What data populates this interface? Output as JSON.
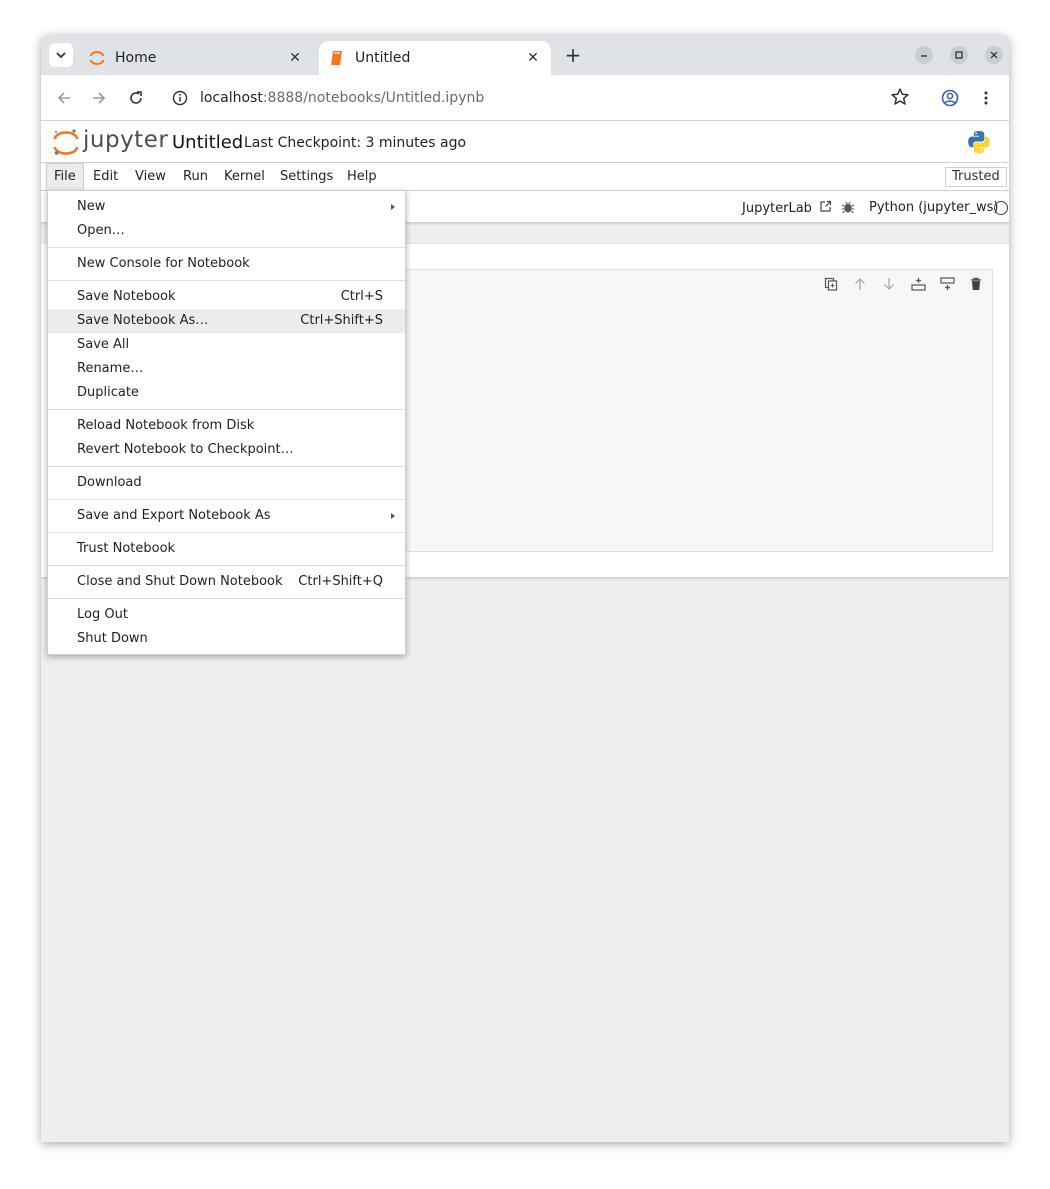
{
  "browser": {
    "tabs": [
      {
        "label": "Home",
        "active": false
      },
      {
        "label": "Untitled",
        "active": true
      }
    ],
    "url_host": "localhost",
    "url_rest": ":8888/notebooks/Untitled.ipynb"
  },
  "jupyter": {
    "wordmark": "jupyter",
    "notebook_title": "Untitled",
    "checkpoint": "Last Checkpoint: 3 minutes ago",
    "menu": [
      "File",
      "Edit",
      "View",
      "Run",
      "Kernel",
      "Settings",
      "Help"
    ],
    "trusted_label": "Trusted",
    "jupyterlab_link": "JupyterLab",
    "kernel_name": "Python (jupyter_ws)"
  },
  "file_menu": {
    "groups": [
      [
        {
          "label": "New",
          "submenu": true
        },
        {
          "label": "Open…"
        }
      ],
      [
        {
          "label": "New Console for Notebook"
        }
      ],
      [
        {
          "label": "Save Notebook",
          "shortcut": "Ctrl+S"
        },
        {
          "label": "Save Notebook As…",
          "shortcut": "Ctrl+Shift+S",
          "hover": true
        },
        {
          "label": "Save All"
        },
        {
          "label": "Rename…"
        },
        {
          "label": "Duplicate"
        }
      ],
      [
        {
          "label": "Reload Notebook from Disk"
        },
        {
          "label": "Revert Notebook to Checkpoint…"
        }
      ],
      [
        {
          "label": "Download"
        }
      ],
      [
        {
          "label": "Save and Export Notebook As",
          "submenu": true
        }
      ],
      [
        {
          "label": "Trust Notebook"
        }
      ],
      [
        {
          "label": "Close and Shut Down Notebook",
          "shortcut": "Ctrl+Shift+Q"
        }
      ],
      [
        {
          "label": "Log Out"
        },
        {
          "label": "Shut Down"
        }
      ]
    ]
  },
  "colors": {
    "jupyter_orange": "#f37726",
    "python_blue": "#3776ab",
    "python_yellow": "#ffd43b"
  }
}
